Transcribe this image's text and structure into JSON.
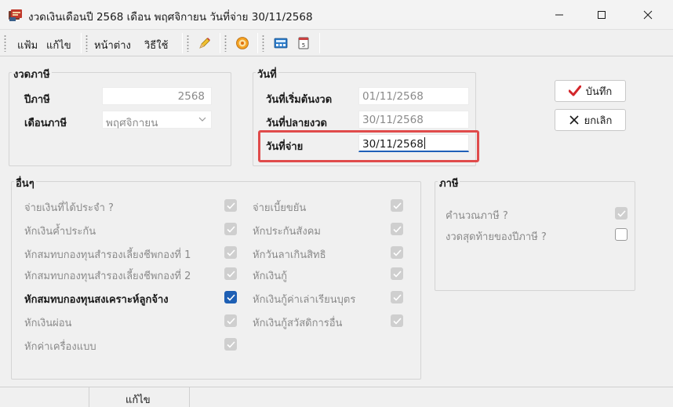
{
  "window": {
    "title": "งวดเงินเดือนปี 2568 เดือน พฤศจิกายน วันที่จ่าย 30/11/2568"
  },
  "menu": {
    "file": "แฟ้ม",
    "edit": "แก้ไข",
    "window": "หน้าต่าง",
    "help": "วิธีใช้"
  },
  "icons": {
    "app": "payroll-app-icon",
    "tool1": "pencil-icon",
    "tool2": "target-icon",
    "tool3": "calculator-icon",
    "tool4": "calendar-icon"
  },
  "tax_period": {
    "title": "งวดภาษี",
    "year_label": "ปีภาษี",
    "year_value": "2568",
    "month_label": "เดือนภาษี",
    "month_value": "พฤศจิกายน"
  },
  "dates": {
    "title": "วันที่",
    "start_label": "วันที่เริ่มต้นงวด",
    "start_value": "01/11/2568",
    "end_label": "วันที่ปลายงวด",
    "end_value": "30/11/2568",
    "pay_label": "วันที่จ่าย",
    "pay_value": "30/11/2568"
  },
  "buttons": {
    "save": "บันทึก",
    "cancel": "ยกเลิก"
  },
  "other": {
    "title": "อื่นๆ",
    "left": [
      {
        "label": "จ่ายเงินที่ได้ประจำ ?",
        "checked": true,
        "enabled": false
      },
      {
        "label": "หักเงินค้ำประกัน",
        "checked": true,
        "enabled": false
      },
      {
        "label": "หักสมทบกองทุนสำรองเลี้ยงชีพกองที่ 1",
        "checked": true,
        "enabled": false
      },
      {
        "label": "หักสมทบกองทุนสำรองเลี้ยงชีพกองที่ 2",
        "checked": true,
        "enabled": false
      },
      {
        "label": "หักสมทบกองทุนสงเคราะห์ลูกจ้าง",
        "checked": true,
        "enabled": true
      },
      {
        "label": "หักเงินผ่อน",
        "checked": true,
        "enabled": false
      },
      {
        "label": "หักค่าเครื่องแบบ",
        "checked": true,
        "enabled": false
      }
    ],
    "right": [
      {
        "label": "จ่ายเบี้ยขยัน",
        "checked": true,
        "enabled": false
      },
      {
        "label": "หักประกันสังคม",
        "checked": true,
        "enabled": false
      },
      {
        "label": "หักวันลาเกินสิทธิ",
        "checked": true,
        "enabled": false
      },
      {
        "label": "หักเงินกู้",
        "checked": true,
        "enabled": false
      },
      {
        "label": "หักเงินกู้ค่าเล่าเรียนบุตร",
        "checked": true,
        "enabled": false
      },
      {
        "label": "หักเงินกู้สวัสดิการอื่น",
        "checked": true,
        "enabled": false
      }
    ]
  },
  "tax": {
    "title": "ภาษี",
    "items": [
      {
        "label": "คำนวณภาษี ?",
        "checked": true,
        "enabled": false
      },
      {
        "label": "งวดสุดท้ายของปีภาษี ?",
        "checked": false,
        "enabled": false
      }
    ]
  },
  "status": {
    "mode": "แก้ไข"
  },
  "colors": {
    "accent": "#1e5fb4",
    "highlight": "#e04b4b",
    "save_check": "#d3262b"
  }
}
